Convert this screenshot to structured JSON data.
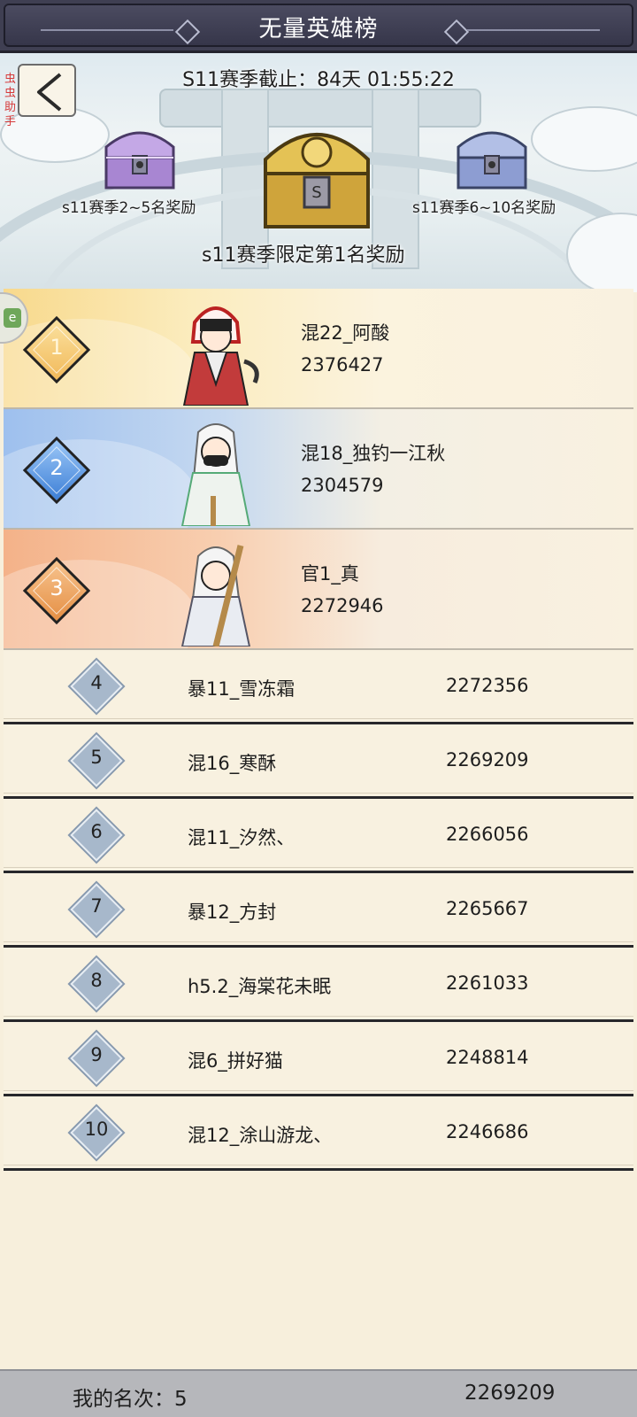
{
  "header": {
    "title": "无量英雄榜",
    "season_countdown": "S11赛季截止：84天 01:55:22"
  },
  "watermark": "虫虫助手",
  "rewards": {
    "left_label": "s11赛季2~5名奖励",
    "center_label": "s11赛季限定第1名奖励",
    "right_label": "s11赛季6~10名奖励"
  },
  "top_ranks": [
    {
      "rank": "1",
      "name": "混22_阿酸",
      "score": "2376427"
    },
    {
      "rank": "2",
      "name": "混18_独钓一江秋",
      "score": "2304579"
    },
    {
      "rank": "3",
      "name": "官1_真",
      "score": "2272946"
    }
  ],
  "ranks": [
    {
      "rank": "4",
      "name": "暴11_雪冻霜",
      "score": "2272356"
    },
    {
      "rank": "5",
      "name": "混16_寒酥",
      "score": "2269209"
    },
    {
      "rank": "6",
      "name": "混11_汐然、",
      "score": "2266056"
    },
    {
      "rank": "7",
      "name": "暴12_方封",
      "score": "2265667"
    },
    {
      "rank": "8",
      "name": "h5.2_海棠花未眠",
      "score": "2261033"
    },
    {
      "rank": "9",
      "name": "混6_拼好猫",
      "score": "2248814"
    },
    {
      "rank": "10",
      "name": "混12_涂山游龙、",
      "score": "2246686"
    }
  ],
  "my_rank": {
    "label": "我的名次：5",
    "score": "2269209"
  },
  "colors": {
    "title_bar": "#3f3f52",
    "rank1": "#f1b95a",
    "rank2": "#3d7fd6",
    "rank3": "#e58f44",
    "list_bg": "#f8f1e0",
    "bottom_bar": "#b6b7bb"
  }
}
